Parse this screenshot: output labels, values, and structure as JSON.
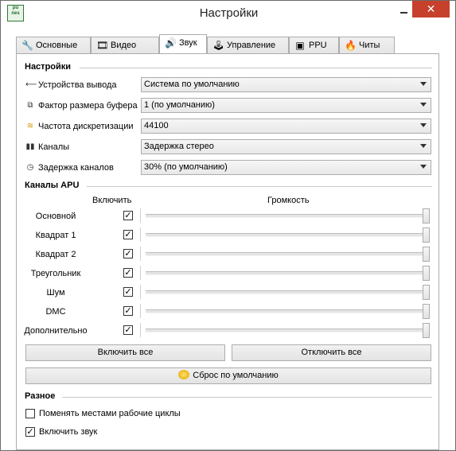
{
  "window": {
    "title": "Настройки",
    "app_icon_text": [
      "pu",
      "nes"
    ],
    "close_glyph": "✕"
  },
  "tabs": [
    {
      "label": "Основные",
      "icon": "wrench-icon",
      "active": false
    },
    {
      "label": "Видео",
      "icon": "film-icon",
      "active": false
    },
    {
      "label": "Звук",
      "icon": "speaker-icon",
      "active": true
    },
    {
      "label": "Управление",
      "icon": "joystick-icon",
      "active": false
    },
    {
      "label": "PPU",
      "icon": "chip-icon",
      "active": false
    },
    {
      "label": "Читы",
      "icon": "fire-icon",
      "active": false
    }
  ],
  "settings": {
    "group_title": "Настройки",
    "rows": [
      {
        "label": "Устройства вывода",
        "icon": "output-icon",
        "value": "Система по умолчанию"
      },
      {
        "label": "Фактор размера буфера",
        "icon": "buffer-icon",
        "value": "1 (по умолчанию)"
      },
      {
        "label": "Частота дискретизации",
        "icon": "waveform-icon",
        "value": "44100"
      },
      {
        "label": "Каналы",
        "icon": "channels-icon",
        "value": "Задержка стерео"
      },
      {
        "label": "Задержка каналов",
        "icon": "clock-icon",
        "value": "30% (по умолчанию)"
      }
    ]
  },
  "apu": {
    "group_title": "Каналы APU",
    "enable_header": "Включить",
    "volume_header": "Громкость",
    "channels": [
      {
        "label": "Основной",
        "enabled": true,
        "volume": 1.0
      },
      {
        "label": "Квадрат 1",
        "enabled": true,
        "volume": 1.0
      },
      {
        "label": "Квадрат 2",
        "enabled": true,
        "volume": 1.0
      },
      {
        "label": "Треугольник",
        "enabled": true,
        "volume": 1.0
      },
      {
        "label": "Шум",
        "enabled": true,
        "volume": 1.0
      },
      {
        "label": "DMC",
        "enabled": true,
        "volume": 1.0
      },
      {
        "label": "Дополнительно",
        "enabled": true,
        "volume": 1.0
      }
    ],
    "enable_all_label": "Включить все",
    "disable_all_label": "Отключить все",
    "reset_label": "Сброс по умолчанию"
  },
  "misc": {
    "group_title": "Разное",
    "swap_duty_label": "Поменять местами рабочие циклы",
    "swap_duty_checked": false,
    "enable_sound_label": "Включить звук",
    "enable_sound_checked": true
  }
}
